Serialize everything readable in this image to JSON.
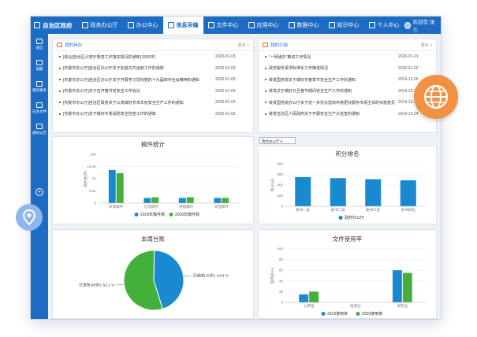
{
  "nav": {
    "brand": "自治区政府",
    "items": [
      "政务办公厅",
      "办公中心",
      "信息采编",
      "文件中心",
      "应用中心",
      "数据中心",
      "知识中心",
      "个人中心"
    ],
    "active_index": 2,
    "user": "欢迎您 张三"
  },
  "sidebar": {
    "items": [
      "收信",
      "提醒",
      "我的事务",
      "已办文件",
      "通知公告"
    ]
  },
  "todo": {
    "title": "我的待办",
    "more": "更多 >",
    "rows": [
      {
        "title": "[综合]自治区公安厅督查工作落实情况的通知(1500字)",
        "date": "2020-01-03"
      },
      {
        "title": "[市委市办公厅]自治区办公厅关于加强文件运转工作的通知",
        "date": "2020-01-03"
      },
      {
        "title": "[市委市办公厅]自治区办公厅关于开展学习贯彻党的十九届四中全会精神的通知",
        "date": "2020-01-03"
      },
      {
        "title": "[市委市办公厅]关于召开春节前安全工作会议",
        "date": "2020-01-03"
      },
      {
        "title": "[市委市办公厅]自治区政府关于认真做好岁末年初安全生产工作的通知",
        "date": "2020-01-03"
      },
      {
        "title": "[市委市办公厅]关于做好冬季消防安全检查工作的通知",
        "date": "2020-01-03"
      }
    ]
  },
  "notice": {
    "title": "我的已阅",
    "more": "更多 >",
    "rows": [
      {
        "title": "“一网通办”推进工作情况",
        "date": "2020-01-21"
      },
      {
        "title": "政务服务事项标准化工作推进情况",
        "date": "2020-01-20"
      },
      {
        "title": "转发国务院关于做好冬春季节安全生产工作的通知",
        "date": "2019-12-26"
      },
      {
        "title": "转发关于做好元旦春节期间安全生产工作的通知",
        "date": "2019-12-25"
      },
      {
        "title": "转发国务院办公厅关于进一步优化营商环境更好服务市场主体的实施意见",
        "date": "2019-12-24"
      },
      {
        "title": "转发自治区人民政府关于开展安全生产大检查的通知",
        "date": "2019-12-24"
      }
    ]
  },
  "chart_data": [
    {
      "type": "bar",
      "title": "稿件统计",
      "categories": [
        "新闻稿件",
        "信息稿件",
        "简报稿件",
        "其他稿件"
      ],
      "series": [
        {
          "name": "2019年稿件数",
          "values": [
            9500,
            1500,
            1500,
            1500
          ],
          "color": "#1a8ad0"
        },
        {
          "name": "2020年稿件数",
          "values": [
            8600,
            1700,
            1700,
            1500
          ],
          "color": "#44b03c"
        }
      ],
      "ylim": [
        0,
        14000
      ],
      "yticks": [
        "0",
        "3.5K",
        "7K",
        "10.5K",
        "14K"
      ],
      "ylabel": "稿件数(件)"
    },
    {
      "type": "bar",
      "title": "积分排名",
      "select": "政务办公厅",
      "categories": [
        "秘书一处",
        "秘书二处",
        "秘书三处",
        "秘书四处"
      ],
      "series": [
        {
          "name": "政府办公厅",
          "values": [
            550,
            530,
            510,
            490
          ],
          "color": "#1a8ad0"
        }
      ],
      "ylim": [
        0,
        800
      ],
      "yticks": [
        "0",
        "200",
        "400",
        "600",
        "800"
      ],
      "ylabel": "积分(分)"
    },
    {
      "type": "pie",
      "title": "本周台账",
      "slices": [
        {
          "label": "已完成(15件): 44.9 %",
          "value": 44.9,
          "color": "#1a8ad0"
        },
        {
          "label": "已发布(40件): 55.1 %",
          "value": 55.1,
          "color": "#44b03c"
        }
      ]
    },
    {
      "type": "bar",
      "title": "文件使用率",
      "categories": [
        "公用电",
        "能源业",
        "采购业"
      ],
      "series": [
        {
          "name": "2019使用率",
          "values": [
            15,
            0,
            60
          ],
          "color": "#1a8ad0"
        },
        {
          "name": "2020使用率",
          "values": [
            20,
            0,
            55
          ],
          "color": "#44b03c"
        }
      ],
      "ylim": [
        0,
        100
      ],
      "yticks": [
        "0",
        "20",
        "40",
        "60",
        "80",
        "100"
      ],
      "ylabel": "使用率(%)"
    }
  ]
}
